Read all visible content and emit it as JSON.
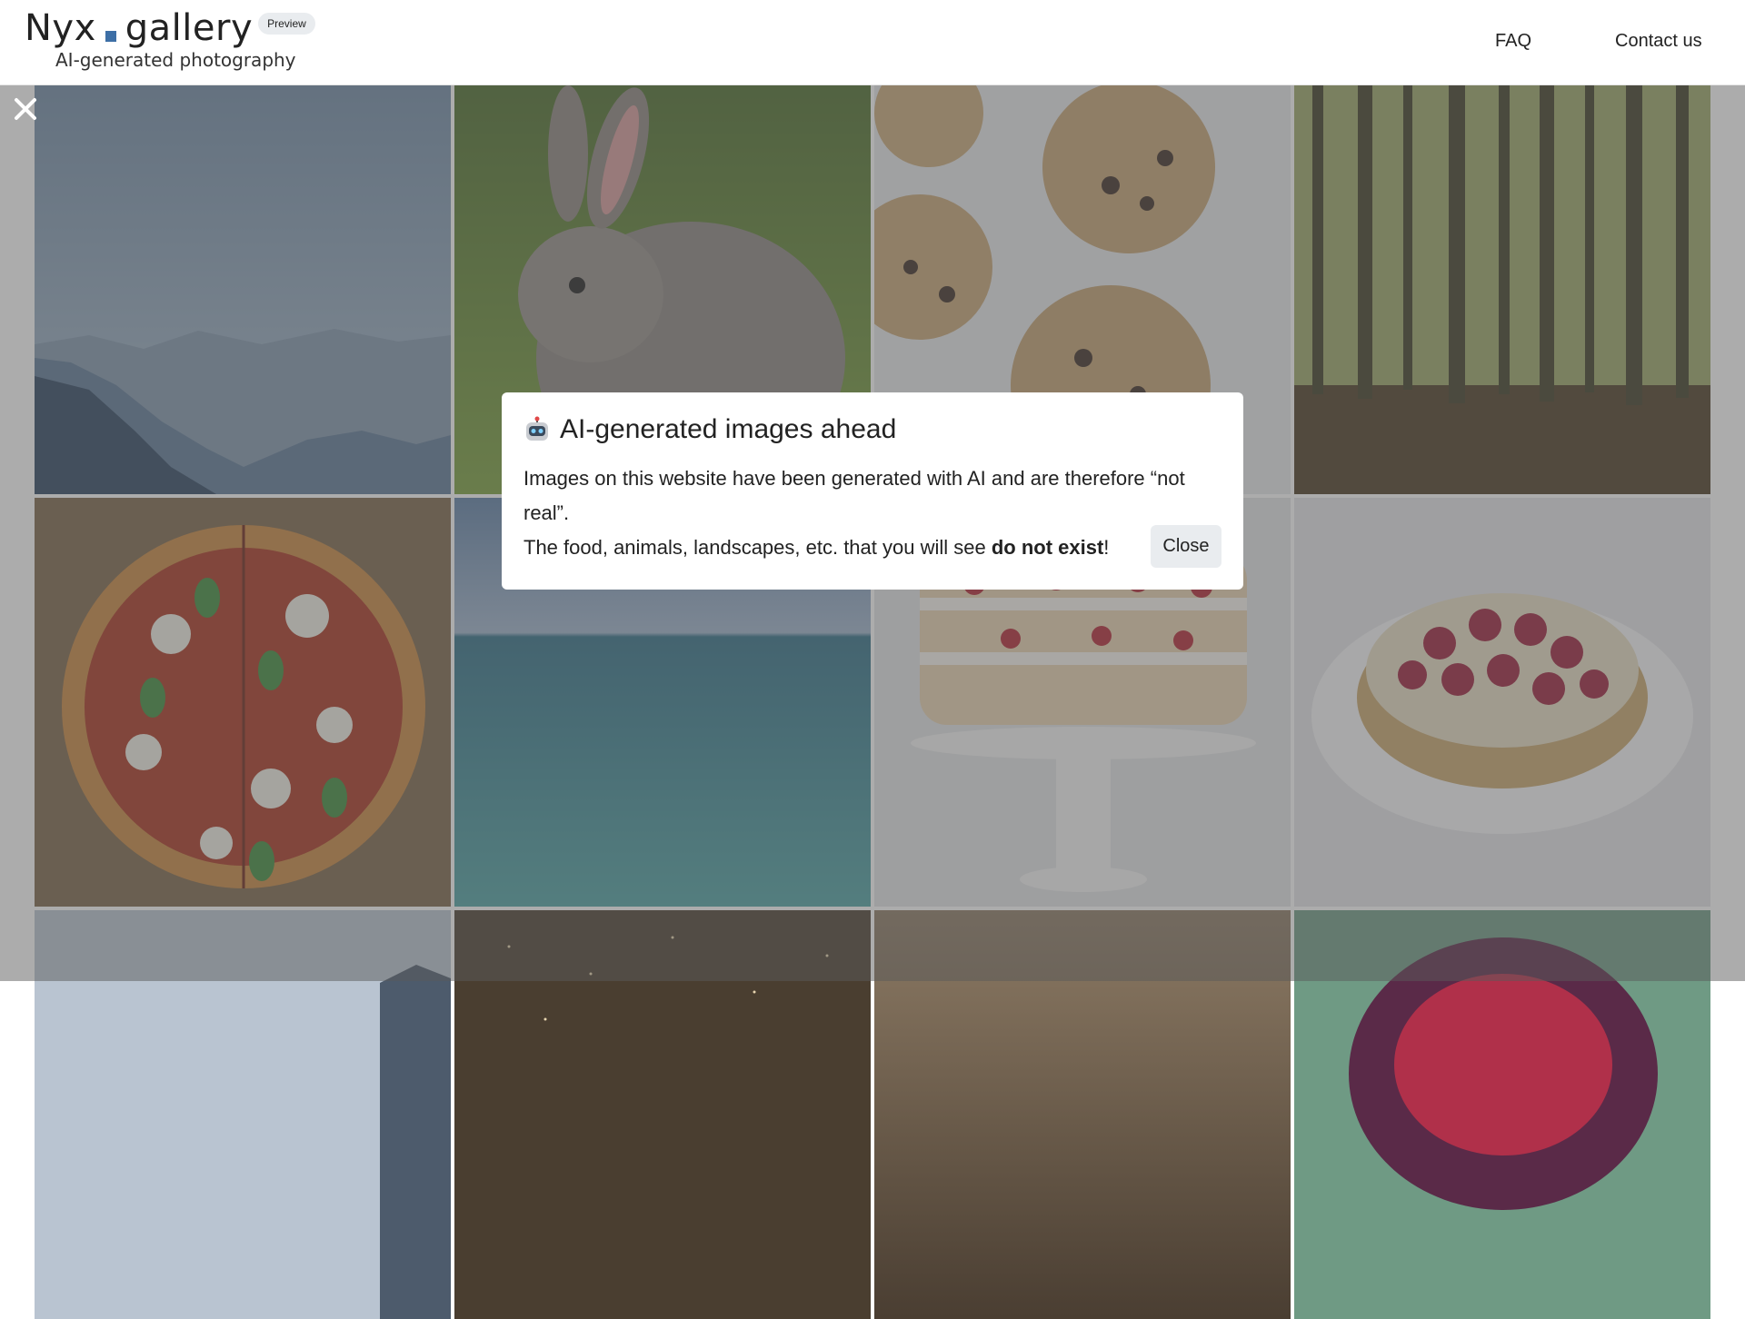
{
  "header": {
    "logo_left": "Nyx",
    "logo_right": "gallery",
    "badge": "Preview",
    "tagline": "AI-generated photography",
    "nav": {
      "faq": "FAQ",
      "contact": "Contact us"
    }
  },
  "colors": {
    "accent": "#3d6fa6",
    "overlay": "rgba(90,90,90,0.5)"
  },
  "gallery": {
    "tiles": [
      "mountains",
      "rabbit",
      "cookies",
      "forest",
      "pizza",
      "ocean",
      "strawberry-cake",
      "raspberry-cheesecake",
      "mountain-sky",
      "night-sky",
      "dark-surface",
      "fig"
    ]
  },
  "modal": {
    "icon": "robot-icon",
    "title": "AI-generated images ahead",
    "line1": "Images on this website have been generated with AI and are therefore “not real”.",
    "line2_prefix": "The food, animals, landscapes, etc. that you will see ",
    "line2_bold": "do not exist",
    "line2_suffix": "!",
    "close_label": "Close"
  }
}
